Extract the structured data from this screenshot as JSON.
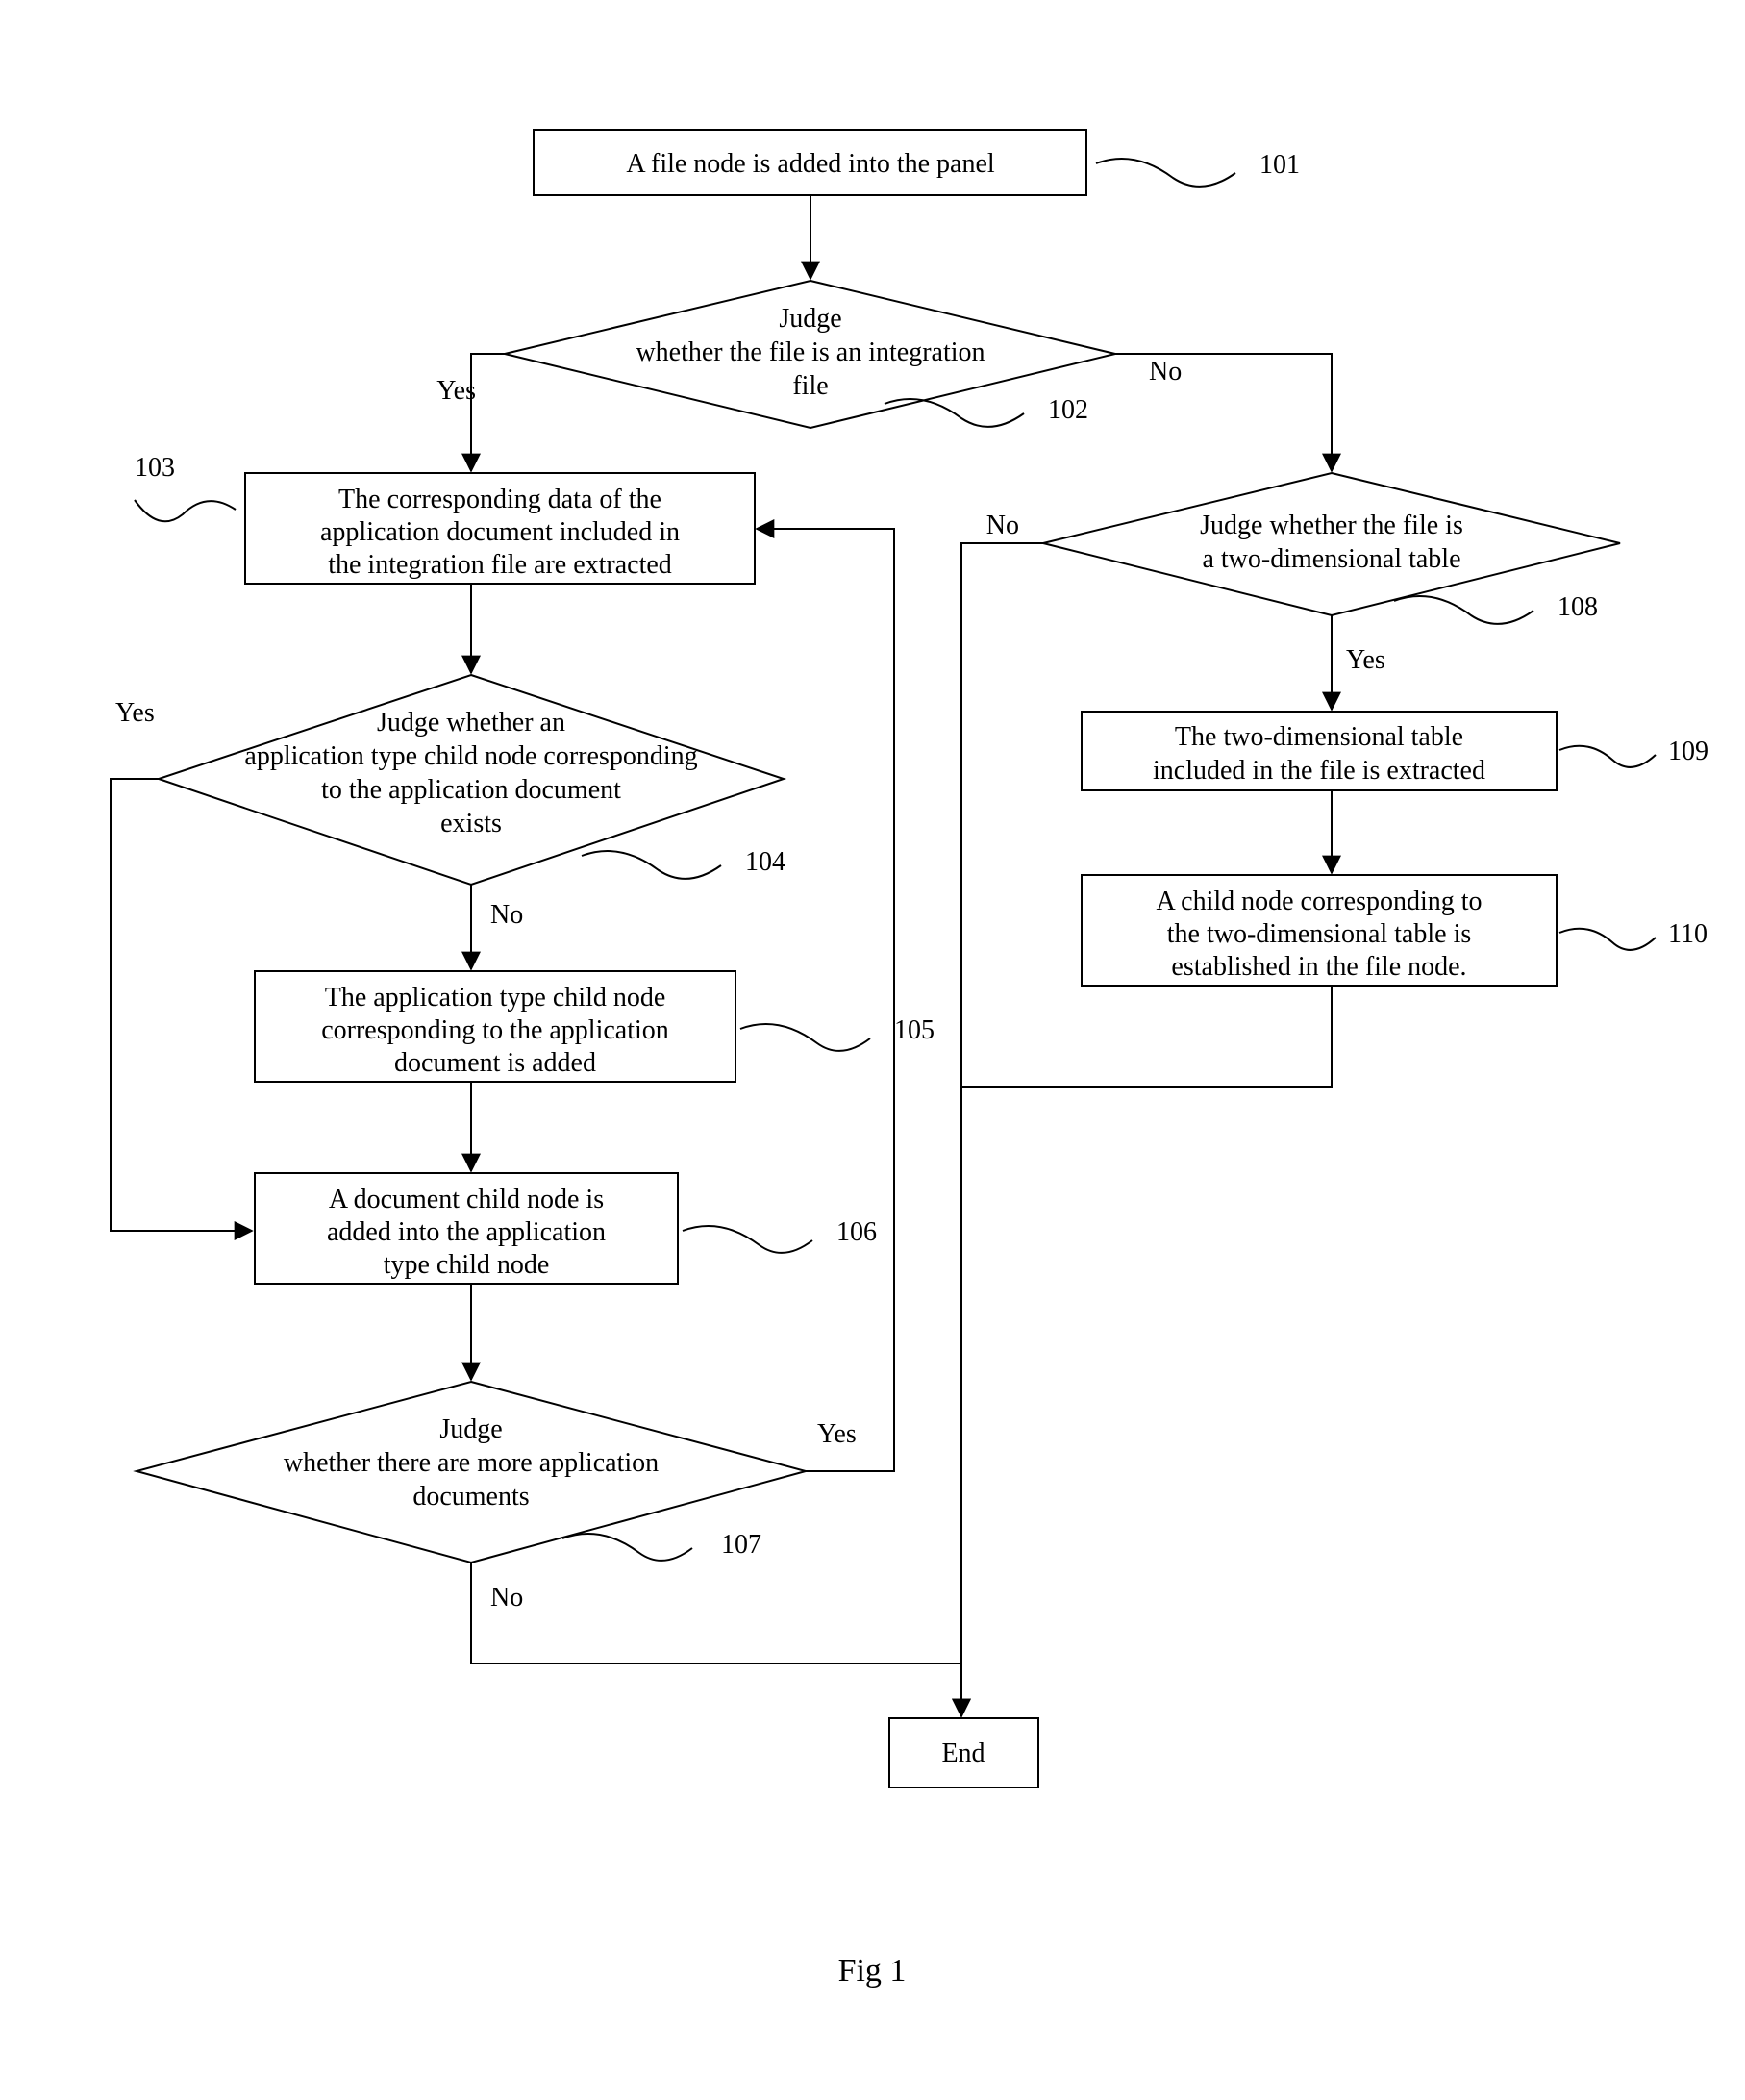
{
  "chart_data": {
    "type": "flowchart",
    "nodes": {
      "n101": {
        "num": "101",
        "text": "A file node is added into the panel",
        "shape": "rect"
      },
      "n102": {
        "num": "102",
        "text": "Judge whether the file is an integration file",
        "shape": "diamond"
      },
      "n103": {
        "num": "103",
        "text": "The corresponding data of the application document included in the integration file are extracted",
        "shape": "rect"
      },
      "n104": {
        "num": "104",
        "text": "Judge whether an application type child node corresponding to the application document exists",
        "shape": "diamond"
      },
      "n105": {
        "num": "105",
        "text": "The application type child node corresponding to the application document is added",
        "shape": "rect"
      },
      "n106": {
        "num": "106",
        "text": "A document child node is added into the application type child node",
        "shape": "rect"
      },
      "n107": {
        "num": "107",
        "text": "Judge whether there are more application documents",
        "shape": "diamond"
      },
      "n108": {
        "num": "108",
        "text": "Judge whether the file is a two-dimensional table",
        "shape": "diamond"
      },
      "n109": {
        "num": "109",
        "text": "The two-dimensional table included in the file is extracted",
        "shape": "rect"
      },
      "n110": {
        "num": "110",
        "text": "A child node corresponding to the two-dimensional table is established in the file node.",
        "shape": "rect"
      }
    },
    "end_label": "End",
    "edge_labels": {
      "yes": "Yes",
      "no": "No"
    },
    "caption": "Fig 1"
  }
}
